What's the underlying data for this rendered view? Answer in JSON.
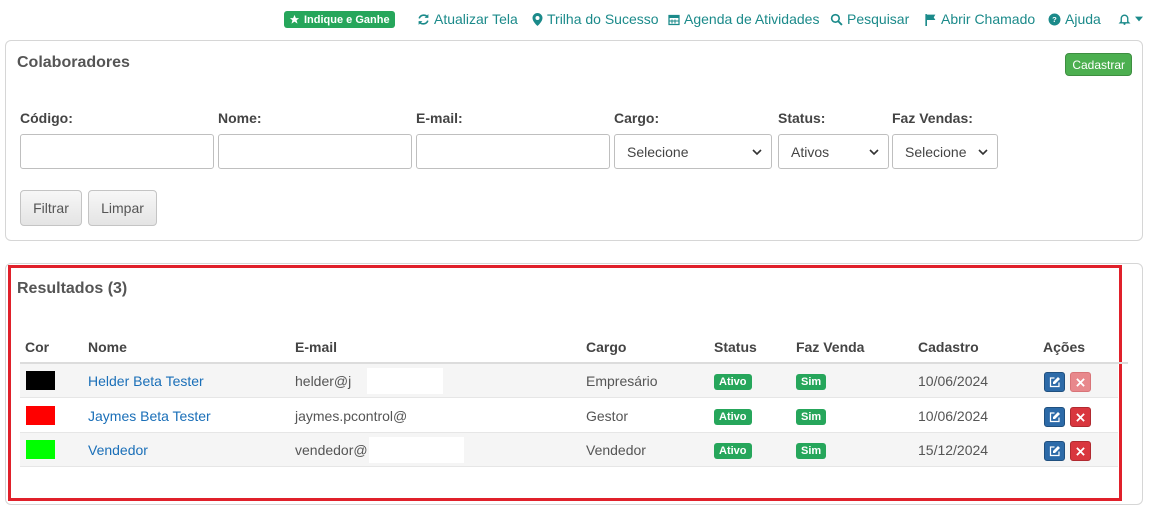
{
  "topnav": {
    "indique": "Indique e Ganhe",
    "items": [
      "Atualizar Tela",
      "Trilha do Sucesso",
      "Agenda de Atividades",
      "Pesquisar",
      "Abrir Chamado",
      "Ajuda"
    ]
  },
  "filter": {
    "title": "Colaboradores",
    "cadastrar": "Cadastrar",
    "labels": {
      "codigo": "Código:",
      "nome": "Nome:",
      "email": "E-mail:",
      "cargo": "Cargo:",
      "status": "Status:",
      "faz_vendas": "Faz Vendas:"
    },
    "values": {
      "codigo": "",
      "nome": "",
      "email": "",
      "cargo": "Selecione",
      "status": "Ativos",
      "faz_vendas": "Selecione"
    },
    "buttons": {
      "filtrar": "Filtrar",
      "limpar": "Limpar"
    }
  },
  "results": {
    "title": "Resultados (3)",
    "columns": [
      "Cor",
      "Nome",
      "E-mail",
      "Cargo",
      "Status",
      "Faz Venda",
      "Cadastro",
      "Ações"
    ],
    "rows": [
      {
        "color": "#000000",
        "nome": "Helder Beta Tester",
        "email": "helder@j",
        "cargo": "Empresário",
        "status": "Ativo",
        "faz_venda": "Sim",
        "cadastro": "10/06/2024"
      },
      {
        "color": "#ff0000",
        "nome": "Jaymes Beta Tester",
        "email": "jaymes.pcontrol@",
        "cargo": "Gestor",
        "status": "Ativo",
        "faz_venda": "Sim",
        "cadastro": "10/06/2024"
      },
      {
        "color": "#00ff00",
        "nome": "Vendedor",
        "email": "vendedor@",
        "cargo": "Vendedor",
        "status": "Ativo",
        "faz_venda": "Sim",
        "cadastro": "15/12/2024"
      }
    ]
  },
  "colors": {
    "accent": "#1b8a8a",
    "success": "#26a65b",
    "link": "#1a6fb8",
    "highlight": "#e0202a"
  }
}
